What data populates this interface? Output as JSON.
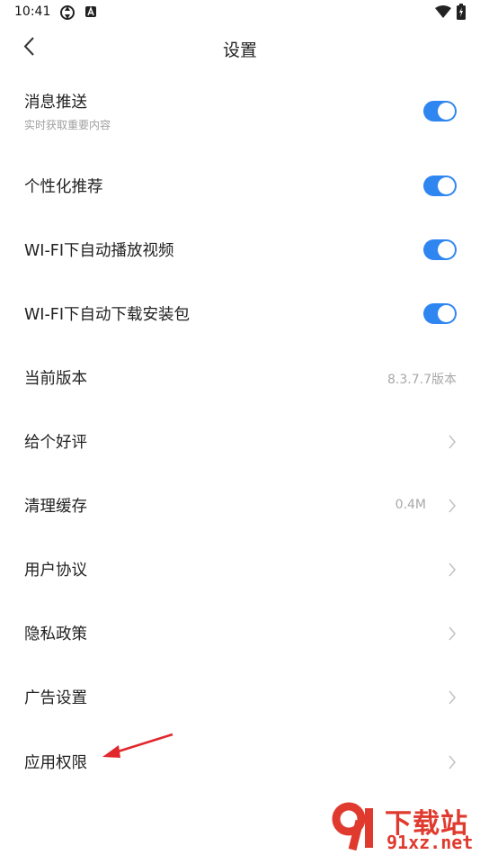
{
  "status_bar": {
    "time": "10:41"
  },
  "header": {
    "title": "设置"
  },
  "rows": {
    "push": {
      "label": "消息推送",
      "sub": "实时获取重要内容",
      "on": true
    },
    "personalized": {
      "label": "个性化推荐",
      "on": true
    },
    "wifi_autoplay": {
      "label": "WI-FI下自动播放视频",
      "on": true
    },
    "wifi_download": {
      "label": "WI-FI下自动下载安装包",
      "on": true
    },
    "version": {
      "label": "当前版本",
      "value": "8.3.7.7版本"
    },
    "rate": {
      "label": "给个好评"
    },
    "clear_cache": {
      "label": "清理缓存",
      "value": "0.4M"
    },
    "user_agreement": {
      "label": "用户协议"
    },
    "privacy": {
      "label": "隐私政策"
    },
    "ad_settings": {
      "label": "广告设置"
    },
    "app_permissions": {
      "label": "应用权限"
    }
  },
  "watermark": {
    "brand": "下载站",
    "domain": "91xz.net"
  },
  "colors": {
    "accent": "#2f86f0",
    "annotation_arrow": "#e0282d",
    "watermark": "#e03a2f"
  }
}
